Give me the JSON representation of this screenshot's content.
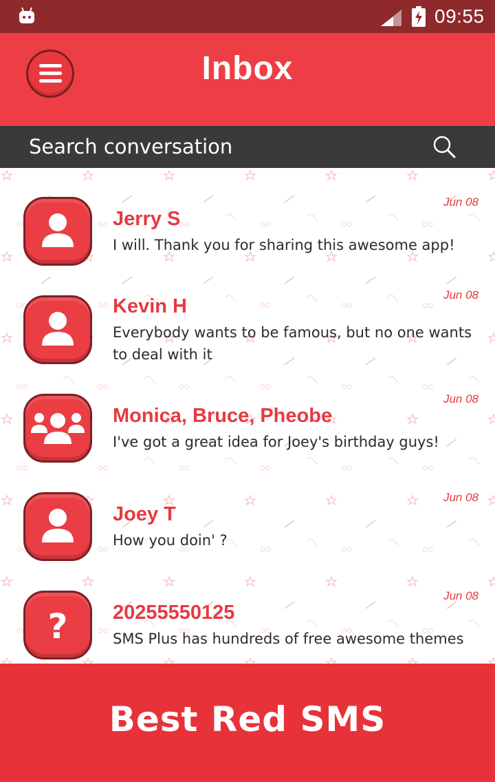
{
  "status_bar": {
    "time": "09:55"
  },
  "header": {
    "title": "Inbox"
  },
  "search": {
    "placeholder": "Search conversation"
  },
  "conversations": [
    {
      "name": "Jerry S",
      "message": "I will. Thank you for sharing this awesome app!",
      "date": "Jun 08",
      "avatar": "person-icon"
    },
    {
      "name": "Kevin H",
      "message": "Everybody wants to be famous, but no one wants to deal with it",
      "date": "Jun 08",
      "avatar": "person-icon"
    },
    {
      "name": "Monica, Bruce, Pheobe",
      "message": "I've got a great idea for Joey's birthday guys!",
      "date": "Jun 08",
      "avatar": "group-icon"
    },
    {
      "name": "Joey T",
      "message": "How you doin' ?",
      "date": "Jun 08",
      "avatar": "person-icon"
    },
    {
      "name": "20255550125",
      "message": "SMS Plus has hundreds of free awesome themes",
      "date": "Jun 08",
      "avatar": "unknown-contact-icon"
    }
  ],
  "banner": {
    "text": "Best Red SMS"
  },
  "colors": {
    "accent": "#ee3e45",
    "status_bar": "#8f2a2c",
    "search_bar": "#3a3a3a",
    "banner": "#e8323a"
  }
}
